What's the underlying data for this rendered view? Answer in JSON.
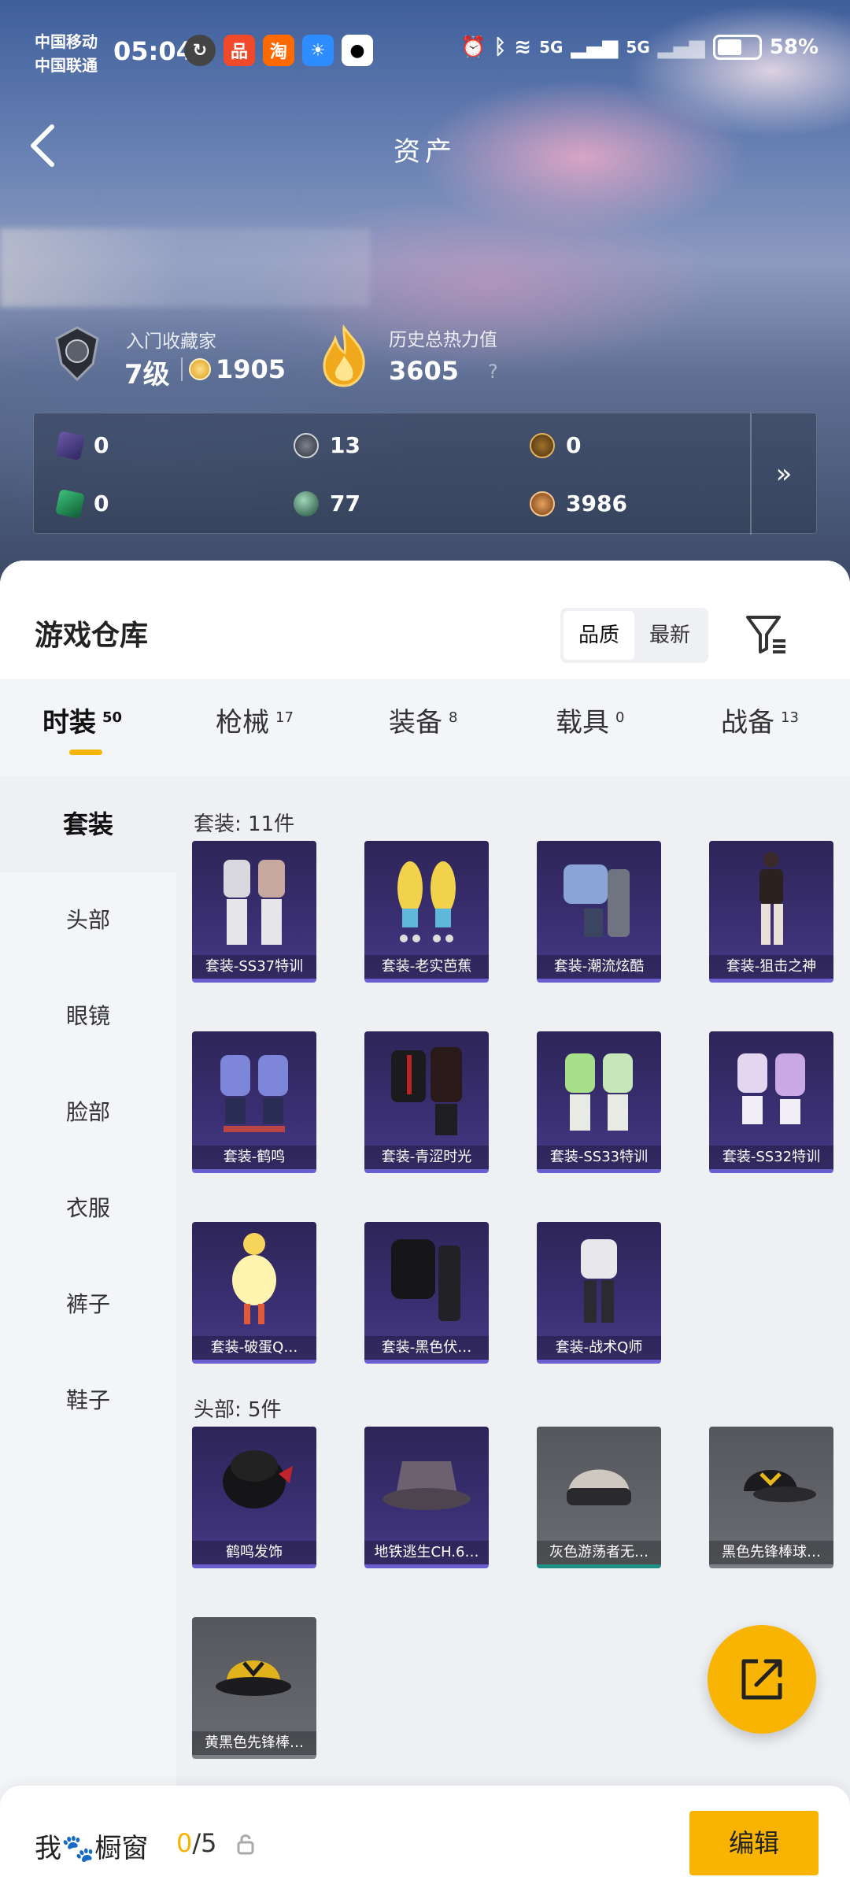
{
  "status_bar": {
    "carrier_1": "中国移动",
    "carrier_2": "中国联通",
    "time": "05:04",
    "battery": "58%",
    "net_1": "5G",
    "net_2": "5G"
  },
  "header": {
    "title": "资产"
  },
  "profile": {
    "rank_label": "入门收藏家",
    "rank_level": "7级",
    "rank_points": "1905",
    "heat_label": "历史总热力值",
    "heat_value": "3605",
    "heat_help": "?"
  },
  "currencies": [
    {
      "icon": "purple-card-icon",
      "value": "0"
    },
    {
      "icon": "coin-s-icon",
      "value": "13"
    },
    {
      "icon": "badge-a-icon",
      "value": "0"
    },
    {
      "icon": "green-card-icon",
      "value": "0"
    },
    {
      "icon": "sphere-icon",
      "value": "77"
    },
    {
      "icon": "bronze-coin-icon",
      "value": "3986"
    }
  ],
  "warehouse": {
    "title": "游戏仓库",
    "sort": [
      "品质",
      "最新"
    ]
  },
  "tabs": [
    {
      "label": "时装",
      "count": "50"
    },
    {
      "label": "枪械",
      "count": "17"
    },
    {
      "label": "装备",
      "count": "8"
    },
    {
      "label": "载具",
      "count": "0"
    },
    {
      "label": "战备",
      "count": "13"
    }
  ],
  "sidebar": [
    "套装",
    "头部",
    "眼镜",
    "脸部",
    "衣服",
    "裤子",
    "鞋子"
  ],
  "sections": [
    {
      "title": "套装: 11件",
      "items": [
        "套装-SS37特训",
        "套装-老实芭蕉",
        "套装-潮流炫酷",
        "套装-狙击之神",
        "套装-鹤鸣",
        "套装-青涩时光",
        "套装-SS33特训",
        "套装-SS32特训",
        "套装-破蛋Q…",
        "套装-黑色伏…",
        "套装-战术Q师"
      ]
    },
    {
      "title": "头部: 5件",
      "items": [
        "鹤鸣发饰",
        "地铁逃生CH.6…",
        "灰色游荡者无…",
        "黑色先锋棒球…",
        "黄黑色先锋棒…"
      ]
    }
  ],
  "bottom_bar": {
    "label": "我🐾橱窗",
    "count_current": "0",
    "count_total": "/5",
    "edit": "编辑"
  },
  "colors": {
    "accent": "#f8b400",
    "card_purple": "#3a2f72",
    "card_gray": "#6a6c72"
  }
}
